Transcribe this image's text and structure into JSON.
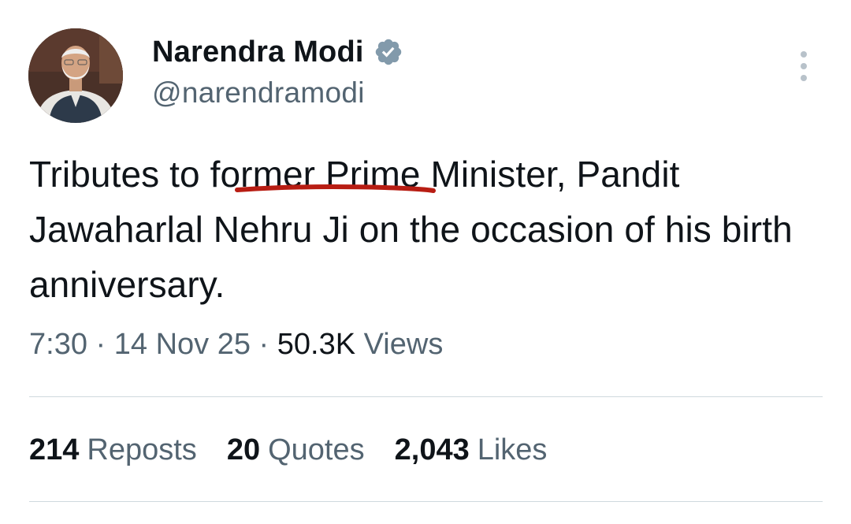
{
  "author": {
    "display_name": "Narendra Modi",
    "handle": "@narendramodi",
    "verified": true,
    "verified_badge_color": "#829aab"
  },
  "tweet": {
    "text_before": "Tributes to ",
    "text_highlight": "former Pri",
    "text_after": "me Minister, Pandit Jawaharlal Nehru Ji on the occasion of his birth anniversary.",
    "annotation_color": "#b81d13"
  },
  "meta": {
    "time": "7:30",
    "separator": "·",
    "date": "14 Nov 25",
    "views_count": "50.3K",
    "views_label": "Views"
  },
  "stats": [
    {
      "count": "214",
      "label": "Reposts"
    },
    {
      "count": "20",
      "label": "Quotes"
    },
    {
      "count": "2,043",
      "label": "Likes"
    }
  ],
  "icons": {
    "more": "more-vertical-icon",
    "verified": "verified-badge-icon"
  },
  "colors": {
    "text_primary": "#0f1419",
    "text_secondary": "#536471",
    "divider": "#cfd9de"
  }
}
